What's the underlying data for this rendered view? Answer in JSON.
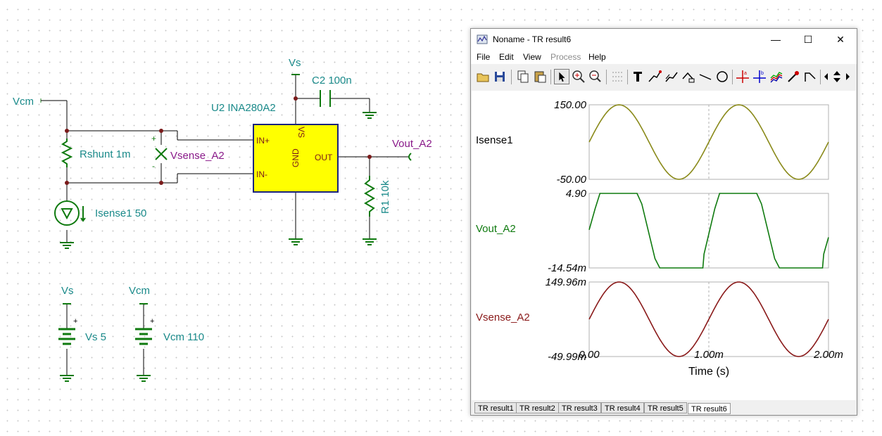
{
  "schematic": {
    "vcm_node_label": "Vcm",
    "rshunt_label": "Rshunt 1m",
    "vsense_label": "Vsense_A2",
    "isense_label": "Isense1 50",
    "vs_supply_label": "Vs",
    "c2_label": "C2 100n",
    "u2_label": "U2 INA280A2",
    "pin_in_plus": "IN+",
    "pin_in_minus": "IN-",
    "pin_vs": "VS",
    "pin_gnd": "GND",
    "pin_out": "OUT",
    "vout_label": "Vout_A2",
    "r1_label": "R1 10k",
    "vs_source_node": "Vs",
    "vs_source_value": "Vs 5",
    "vcm_source_node": "Vcm",
    "vcm_source_value": "Vcm 110",
    "plus_sign": "+",
    "minus_sign": "-"
  },
  "window": {
    "title": "Noname - TR result6",
    "minimize": "—",
    "maximize": "☐",
    "close": "✕"
  },
  "menu": [
    "File",
    "Edit",
    "View",
    "Process",
    "Help"
  ],
  "toolbar_icons": [
    "open-icon",
    "save-icon",
    "copy-icon",
    "paste-icon",
    "pointer-icon",
    "zoom-in-icon",
    "zoom-100-icon",
    "grid-icon",
    "text-icon",
    "curve-tool-icon",
    "curve-tool2-icon",
    "curve-tool3-icon",
    "line-icon",
    "circle-icon",
    "cursor-a-icon",
    "cursor-b-icon",
    "bundle-icon",
    "probe-icon",
    "step-icon",
    "scroll-left-icon",
    "scroll-updown-icon",
    "scroll-right-icon"
  ],
  "plot": {
    "xlabel": "Time (s)",
    "xticks": [
      "0.00",
      "1.00m",
      "2.00m"
    ]
  },
  "chart_data": [
    {
      "type": "line",
      "name": "Isense1",
      "color": "#8a8a1a",
      "y_top_label": "150.00",
      "y_bottom_label": "-50.00",
      "ylim": [
        -50,
        150
      ],
      "x": [
        0,
        0.0002,
        0.0004,
        0.0006,
        0.0008,
        0.001,
        0.0012,
        0.0014,
        0.0016,
        0.0018,
        0.002
      ],
      "y": [
        50,
        145,
        109,
        -9,
        -45,
        50,
        145,
        109,
        -9,
        -45,
        50
      ]
    },
    {
      "type": "line",
      "name": "Vout_A2",
      "color": "#0f7a0f",
      "y_top_label": "4.90",
      "y_bottom_label": "-14.54m",
      "ylim": [
        -0.01454,
        4.9
      ],
      "x": [
        0,
        5e-05,
        9e-05,
        0.0004,
        0.00044,
        0.00055,
        0.00059,
        0.00095,
        0.00096,
        0.00105,
        0.00109,
        0.0014,
        0.00144,
        0.00155,
        0.00159,
        0.00195,
        0.00196,
        0.002
      ],
      "y": [
        2.5,
        3.9,
        4.9,
        4.9,
        4.2,
        0.6,
        -0.0145,
        -0.0145,
        0.9,
        3.9,
        4.9,
        4.9,
        4.2,
        0.6,
        -0.0145,
        -0.0145,
        0.9,
        2.0
      ]
    },
    {
      "type": "line",
      "name": "Vsense_A2",
      "color": "#8a1a1a",
      "y_top_label": "149.96m",
      "y_bottom_label": "-49.99m",
      "ylim": [
        -0.04999,
        0.14996
      ],
      "x": [
        0,
        0.0002,
        0.0004,
        0.0006,
        0.0008,
        0.001,
        0.0012,
        0.0014,
        0.0016,
        0.0018,
        0.002
      ],
      "y": [
        0.05,
        0.145,
        0.109,
        -0.009,
        -0.045,
        0.05,
        0.145,
        0.109,
        -0.009,
        -0.045,
        0.05
      ]
    }
  ],
  "tabs": [
    "TR result1",
    "TR result2",
    "TR result3",
    "TR result4",
    "TR result5",
    "TR result6"
  ]
}
